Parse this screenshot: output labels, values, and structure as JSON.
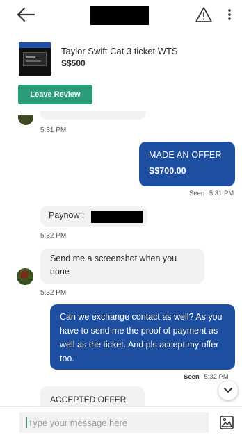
{
  "header": {
    "back_icon": "arrow-left-icon",
    "report_icon": "warning-triangle-icon",
    "more_icon": "more-vertical-icon"
  },
  "listing": {
    "title": "Taylor Swift Cat 3 ticket WTS",
    "price": "S$500",
    "review_button": "Leave Review"
  },
  "messages": {
    "partial_time": "5:31 PM",
    "offer": {
      "label": "MADE AN OFFER",
      "amount": "S$700.00",
      "seen": "Seen",
      "time": "5:31 PM"
    },
    "paynow": {
      "text": "Paynow :",
      "time": "5:32 PM"
    },
    "screenshot_msg": {
      "text": "Send me a screenshot when you done",
      "time": "5:32 PM"
    },
    "long_msg": {
      "text": "Can we exchange contact as well? As you have to send me the proof of payment as well as the ticket. And pls accept my offer too.",
      "seen": "Seen",
      "time": "5:32 PM"
    },
    "accepted": {
      "text": "ACCEPTED OFFER"
    }
  },
  "composer": {
    "placeholder": "Type your message here",
    "image_icon": "image-upload-icon"
  },
  "colors": {
    "accent_green": "#2a9d78",
    "bubble_blue": "#1d4ea0",
    "bubble_grey": "#f2f2f2"
  }
}
